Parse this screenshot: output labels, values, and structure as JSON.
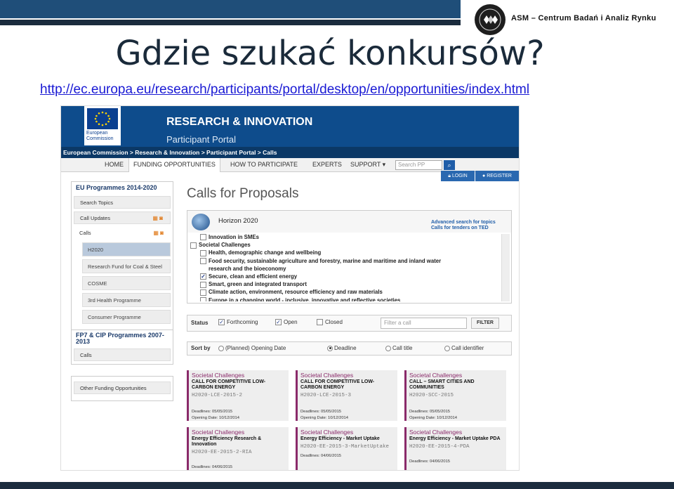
{
  "slide": {
    "brand": "ASM – Centrum Badań i Analiz Rynku",
    "title": "Gdzie szukać konkursów?",
    "url": "http://ec.europa.eu/research/participants/portal/desktop/en/opportunities/index.html",
    "colors": {
      "top_bar": "#1f4e79",
      "title": "#1a2a3a",
      "link": "#1a1ad4"
    }
  },
  "portal": {
    "eu_logo_text": "European Commission",
    "title": "RESEARCH & INNOVATION",
    "subtitle": "Participant Portal",
    "breadcrumbs": "European Commission > Research & Innovation > Participant Portal > Calls",
    "nav": [
      "HOME",
      "FUNDING OPPORTUNITIES",
      "HOW TO PARTICIPATE",
      "EXPERTS",
      "SUPPORT ▾"
    ],
    "search_placeholder": "Search PP",
    "login": "LOGIN",
    "register": "REGISTER",
    "sidebar": {
      "section1_title": "EU Programmes 2014-2020",
      "search_topics": "Search Topics",
      "call_updates": "Call Updates",
      "calls": "Calls",
      "programmes": [
        "H2020",
        "Research Fund for Coal & Steel",
        "COSME",
        "3rd Health Programme",
        "Consumer Programme"
      ],
      "section2_title": "FP7 & CIP Programmes 2007-2013",
      "section2_calls": "Calls",
      "other": "Other Funding Opportunities"
    },
    "page_heading": "Calls for Proposals",
    "programme": "Horizon 2020",
    "advanced_search": "Advanced search for topics",
    "tenders": "Calls for tenders on TED",
    "tree": [
      {
        "label": "Innovation in SMEs",
        "checked": false,
        "level": 1
      },
      {
        "label": "Societal Challenges",
        "checked": false,
        "level": 0
      },
      {
        "label": "Health, demographic change and wellbeing",
        "checked": false,
        "level": 1
      },
      {
        "label": "Food security, sustainable agriculture and forestry, marine and maritime and inland water",
        "checked": false,
        "level": 1
      },
      {
        "label": "research and the bioeconomy",
        "checked": false,
        "level": 2
      },
      {
        "label": "Secure, clean and efficient energy",
        "checked": true,
        "level": 1
      },
      {
        "label": "Smart, green and integrated transport",
        "checked": false,
        "level": 1
      },
      {
        "label": "Climate action, environment, resource efficiency and raw materials",
        "checked": false,
        "level": 1
      },
      {
        "label": "Europe in a changing world - inclusive, innovative and reflective societies",
        "checked": false,
        "level": 1
      }
    ],
    "status": {
      "label": "Status",
      "options": [
        {
          "label": "Forthcoming",
          "checked": true
        },
        {
          "label": "Open",
          "checked": true
        },
        {
          "label": "Closed",
          "checked": false
        }
      ],
      "filter_placeholder": "Filter a call",
      "filter_button": "FILTER"
    },
    "sort": {
      "label": "Sort by",
      "options": [
        {
          "label": "(Planned) Opening Date",
          "selected": false
        },
        {
          "label": "Deadline",
          "selected": true
        },
        {
          "label": "Call title",
          "selected": false
        },
        {
          "label": "Call identifier",
          "selected": false
        }
      ]
    },
    "cards": [
      {
        "category": "Societal Challenges",
        "title": "CALL FOR COMPETITIVE LOW-CARBON ENERGY",
        "code": "H2020-LCE-2015-2",
        "deadline": "Deadlines: 05/05/2015",
        "opening": "Opening Date: 10/12/2014"
      },
      {
        "category": "Societal Challenges",
        "title": "CALL FOR COMPETITIVE LOW-CARBON ENERGY",
        "code": "H2020-LCE-2015-3",
        "deadline": "Deadlines: 05/05/2015",
        "opening": "Opening Date: 10/12/2014"
      },
      {
        "category": "Societal Challenges",
        "title": "CALL – SMART CITIES AND COMMUNITIES",
        "code": "H2020-SCC-2015",
        "deadline": "Deadlines: 05/05/2015",
        "opening": "Opening Date: 10/12/2014"
      },
      {
        "category": "Societal Challenges",
        "title": "Energy Efficiency Research & Innovation",
        "code": "H2020-EE-2015-2-RIA",
        "deadline": "Deadlines: 04/06/2015",
        "opening": ""
      },
      {
        "category": "Societal Challenges",
        "title": "Energy Efficiency - Market Uptake",
        "code": "H2020-EE-2015-3-MarketUptake",
        "deadline": "Deadlines: 04/06/2015",
        "opening": ""
      },
      {
        "category": "Societal Challenges",
        "title": "Energy Efficiency - Market Uptake PDA",
        "code": "H2020-EE-2015-4-PDA",
        "deadline": "Deadlines: 04/06/2015",
        "opening": ""
      }
    ]
  }
}
